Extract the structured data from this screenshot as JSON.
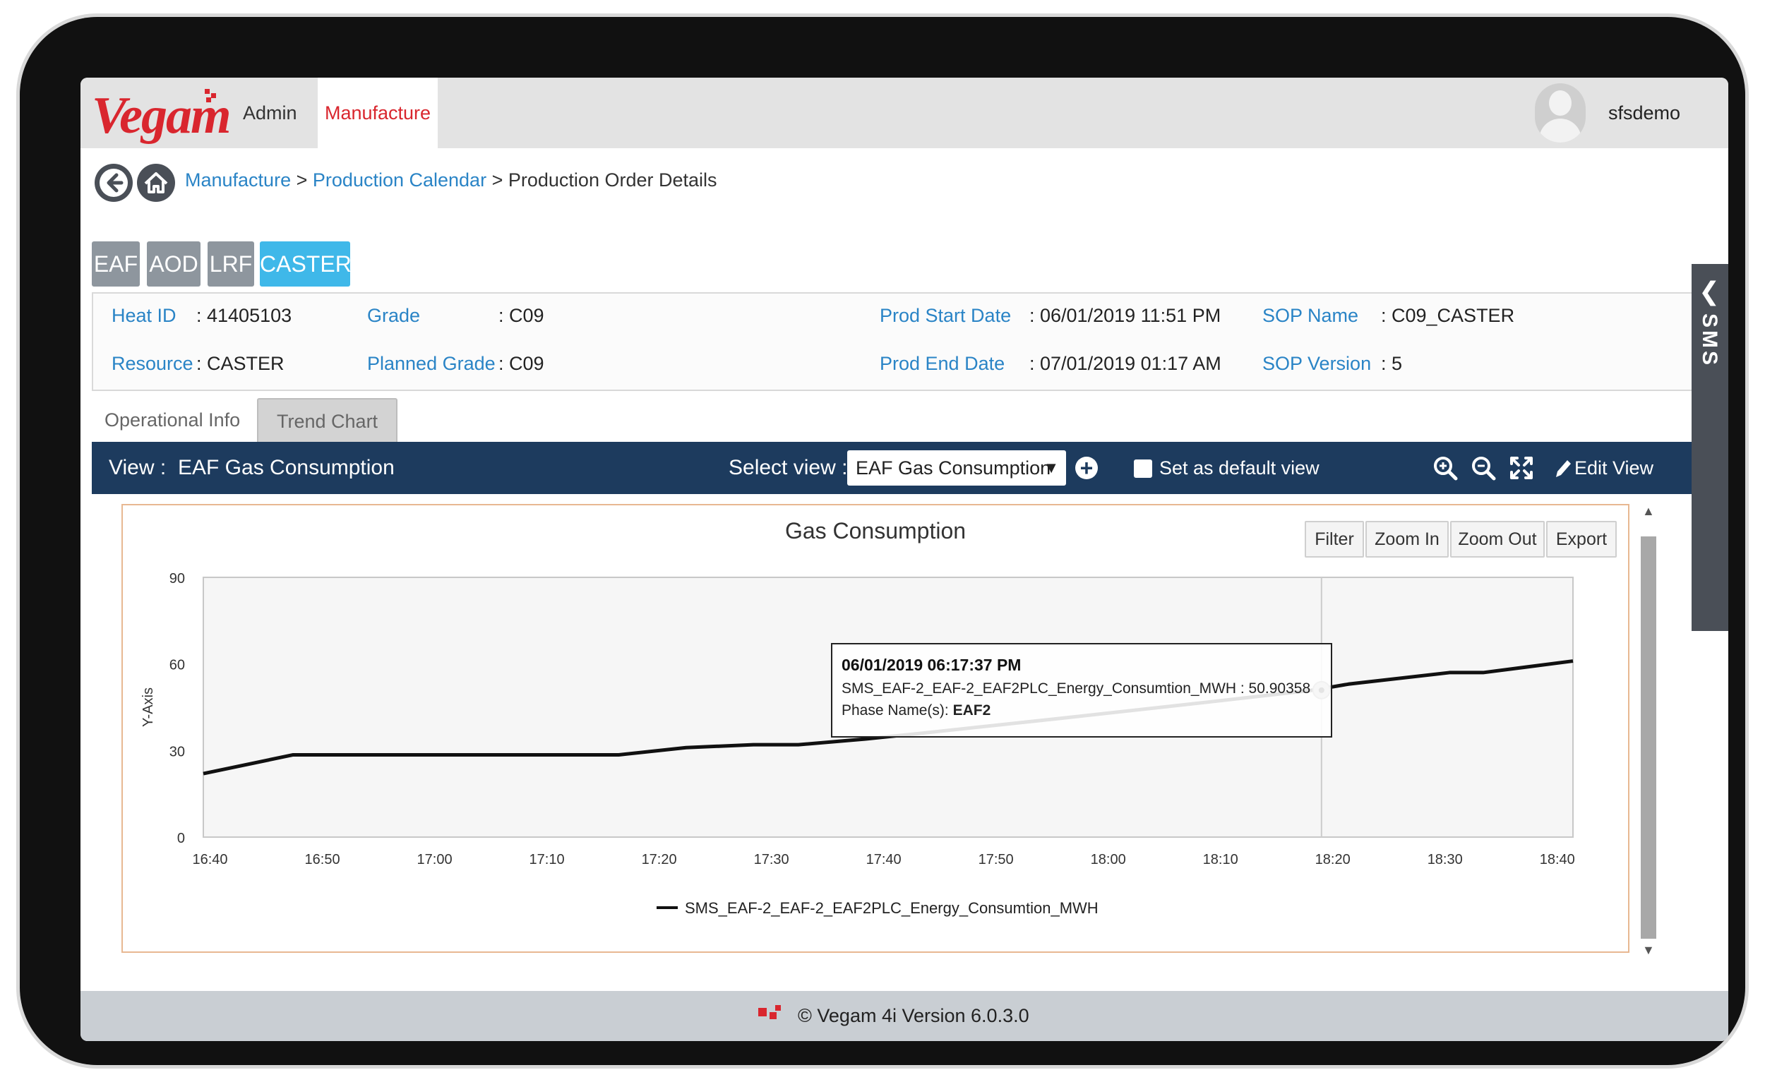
{
  "brand": {
    "name": "Vegam"
  },
  "nav": {
    "admin": "Admin",
    "manufacture": "Manufacture",
    "username": "sfsdemo"
  },
  "breadcrumb": {
    "item1": "Manufacture",
    "item2": "Production Calendar",
    "current": "Production Order Details",
    "sep": ">"
  },
  "phases": [
    "EAF",
    "AOD",
    "LRF",
    "CASTER"
  ],
  "info": {
    "heat_id_label": "Heat ID",
    "heat_id": ": 41405103",
    "grade_label": "Grade",
    "grade": ": C09",
    "prod_start_label": "Prod Start Date",
    "prod_start": ": 06/01/2019 11:51 PM",
    "sop_name_label": "SOP Name",
    "sop_name": ": C09_CASTER",
    "resource_label": "Resource",
    "resource": ": CASTER",
    "planned_grade_label": "Planned Grade",
    "planned_grade": ": C09",
    "prod_end_label": "Prod End Date",
    "prod_end": ": 07/01/2019 01:17 AM",
    "sop_version_label": "SOP Version",
    "sop_version": ": 5"
  },
  "tabs": {
    "operational": "Operational Info",
    "trend": "Trend Chart"
  },
  "viewbar": {
    "view_label": "View :",
    "view_name": "EAF Gas Consumption",
    "select_label": "Select view :",
    "select_value": "EAF Gas Consumption",
    "default_label": "Set as default view",
    "edit_label": "Edit View"
  },
  "side_tab": "SMS",
  "chart_buttons": {
    "filter": "Filter",
    "zoom_in": "Zoom In",
    "zoom_out": "Zoom Out",
    "export": "Export"
  },
  "chart_data": {
    "type": "line",
    "title": "Gas Consumption",
    "ylabel": "Y-Axis",
    "xlabel": "",
    "ylim": [
      0,
      90
    ],
    "yticks": [
      "0",
      "30",
      "60",
      "90"
    ],
    "xticks": [
      "16:40",
      "16:50",
      "17:00",
      "17:10",
      "17:20",
      "17:30",
      "17:40",
      "17:50",
      "18:00",
      "18:10",
      "18:20",
      "18:30",
      "18:40"
    ],
    "xrange_minutes": [
      0,
      122
    ],
    "legend_position": "bottom",
    "series": [
      {
        "name": "SMS_EAF-2_EAF-2_EAF2PLC_Energy_Consumtion_MWH",
        "color": "#111111",
        "x_minutes": [
          0,
          8,
          37,
          43,
          49,
          53,
          59,
          64,
          76,
          90,
          99,
          102,
          111,
          114,
          122
        ],
        "y": [
          22,
          28.5,
          28.5,
          31,
          32,
          32,
          34,
          36,
          41,
          47,
          51,
          53,
          57,
          57,
          61
        ]
      }
    ],
    "tooltip": {
      "time": "06/01/2019 06:17:37 PM",
      "series_text": "SMS_EAF-2_EAF-2_EAF2PLC_Energy_Consumtion_MWH : 50.90358",
      "phase_label": "Phase Name(s):",
      "phase_value": "EAF2",
      "x_minutes": 99.6,
      "y": 50.90358
    }
  },
  "footer": {
    "text": "© Vegam 4i Version 6.0.3.0"
  },
  "colors": {
    "brand_red": "#d9262e",
    "link_blue": "#2a84c6",
    "bar_navy": "#1d3b5e",
    "active_phase": "#3fb8e9"
  }
}
